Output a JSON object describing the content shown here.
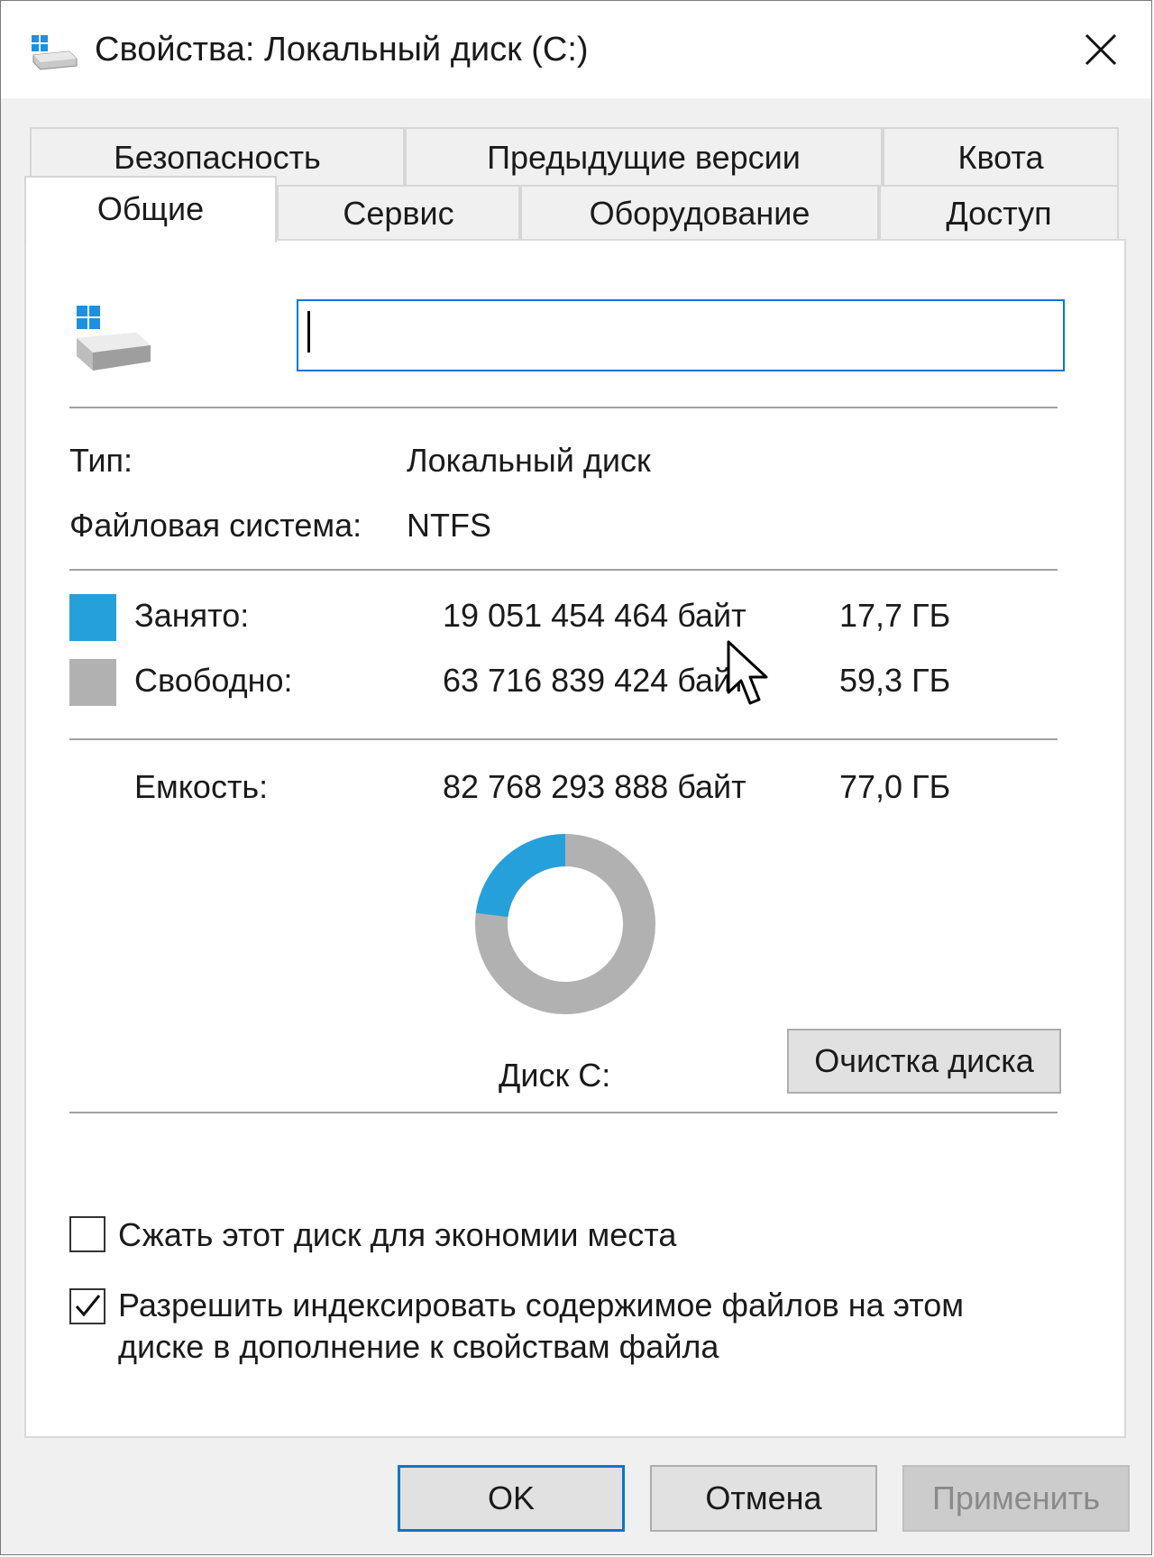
{
  "window": {
    "title": "Свойства: Локальный диск (C:)",
    "icon": "drive-icon",
    "close_icon": "close-icon"
  },
  "tabs": {
    "row_top": [
      "Безопасность",
      "Предыдущие версии",
      "Квота"
    ],
    "row_bottom": [
      "Общие",
      "Сервис",
      "Оборудование",
      "Доступ"
    ],
    "active": "Общие"
  },
  "general": {
    "volume_label_value": "",
    "type_label": "Тип:",
    "type_value": "Локальный диск",
    "fs_label": "Файловая система:",
    "fs_value": "NTFS",
    "used_label": "Занято:",
    "used_bytes": "19 051 454 464 байт",
    "used_gb": "17,7 ГБ",
    "free_label": "Свободно:",
    "free_bytes": "63 716 839 424 байт",
    "free_gb": "59,3 ГБ",
    "capacity_label": "Емкость:",
    "capacity_bytes": "82 768 293 888 байт",
    "capacity_gb": "77,0 ГБ",
    "drive_caption": "Диск C:",
    "cleanup_button": "Очистка диска",
    "used_fraction": 0.2302,
    "used_color": "#26a0da",
    "free_color": "#b1b1b1"
  },
  "options": {
    "compress_label": "Сжать этот диск для экономии места",
    "compress_checked": false,
    "index_label_line1": "Разрешить индексировать содержимое файлов на этом",
    "index_label_line2": "диске в дополнение к свойствам файла",
    "index_checked": true
  },
  "buttons": {
    "ok": "OK",
    "cancel": "Отмена",
    "apply": "Применить"
  }
}
